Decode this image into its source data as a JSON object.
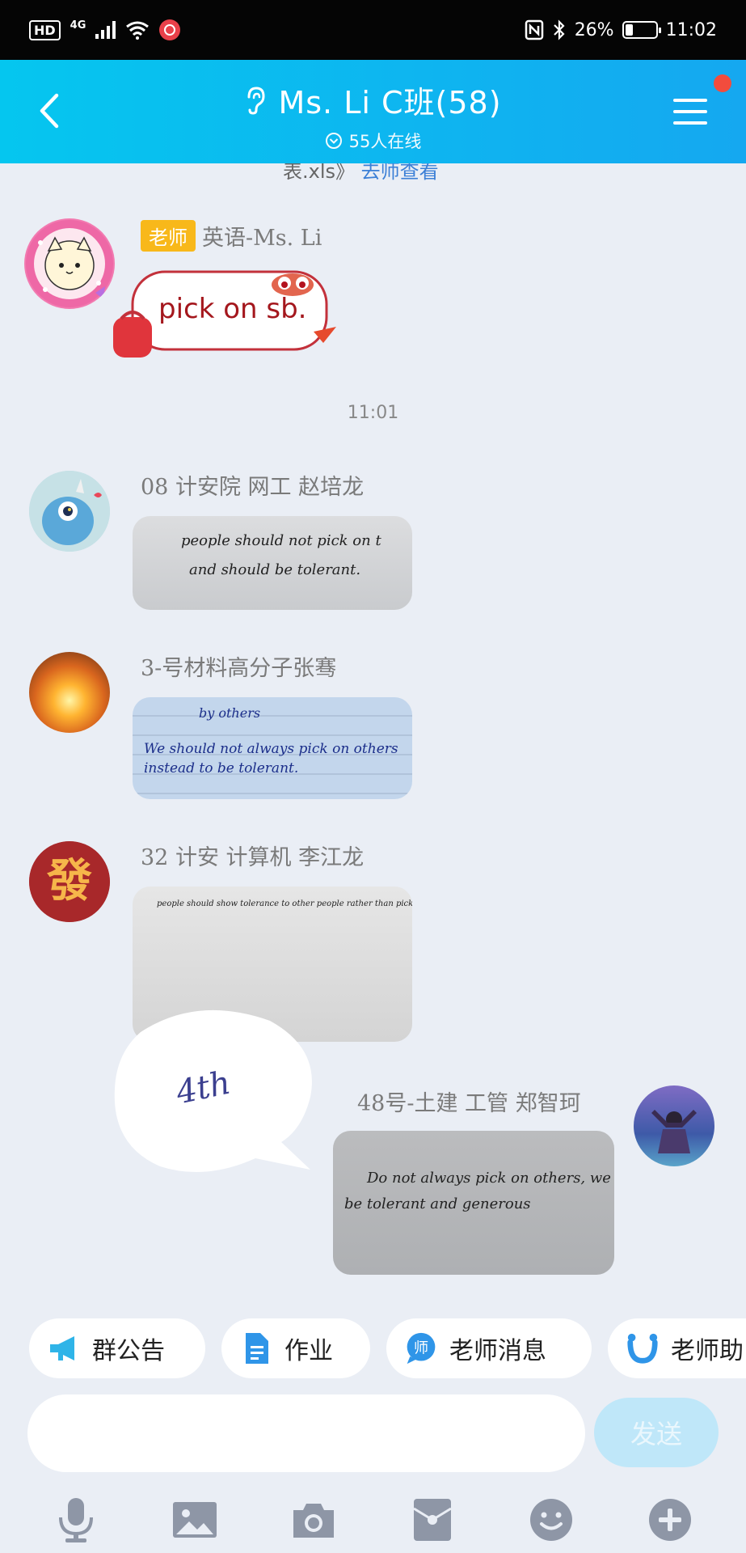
{
  "status_bar": {
    "hd": "HD",
    "network": "4G",
    "battery": "26%",
    "time": "11:02"
  },
  "header": {
    "title": "Ms. Li C班(58)",
    "online": "55人在线"
  },
  "feed": {
    "partial_text": "表.xls》",
    "partial_link": "去师查看",
    "messages": [
      {
        "badge": "老师",
        "sender": "英语-Ms. Li",
        "sticker_text": "pick on sb."
      },
      {
        "sender": "08 计安院 网工 赵培龙",
        "photo_lines": [
          "people  should  not  pick  on  t",
          "and  should  be  tolerant."
        ]
      },
      {
        "sender": "3-号材料高分子张骞",
        "photo_lines": [
          "by others",
          "We should not always pick on others",
          "instead to be tolerant."
        ]
      },
      {
        "sender": "32 计安 计算机 李江龙",
        "photo_lines": [
          "people should show tolerance to other people rather than pick on others."
        ]
      },
      {
        "sender": "48号-土建 工管 郑智珂",
        "photo_lines": [
          "Do not always pick on others, we should",
          "be tolerant and generous"
        ]
      }
    ],
    "time_divider": "11:01",
    "speech_sticker": "4th"
  },
  "chips": [
    {
      "label": "群公告",
      "icon": "megaphone-icon"
    },
    {
      "label": "作业",
      "icon": "document-icon"
    },
    {
      "label": "老师消息",
      "icon": "teacher-message-icon"
    },
    {
      "label": "老师助",
      "icon": "assistant-icon"
    }
  ],
  "input": {
    "placeholder": "",
    "send_label": "发送"
  },
  "bottom_icons": [
    "microphone-icon",
    "image-icon",
    "camera-icon",
    "red-packet-icon",
    "emoji-icon",
    "plus-icon"
  ],
  "colors": {
    "header_start": "#05c6ef",
    "header_end": "#15a8f0",
    "badge": "#f8b81a",
    "send_disabled": "#bfe7f9",
    "background": "#eaeef5"
  }
}
